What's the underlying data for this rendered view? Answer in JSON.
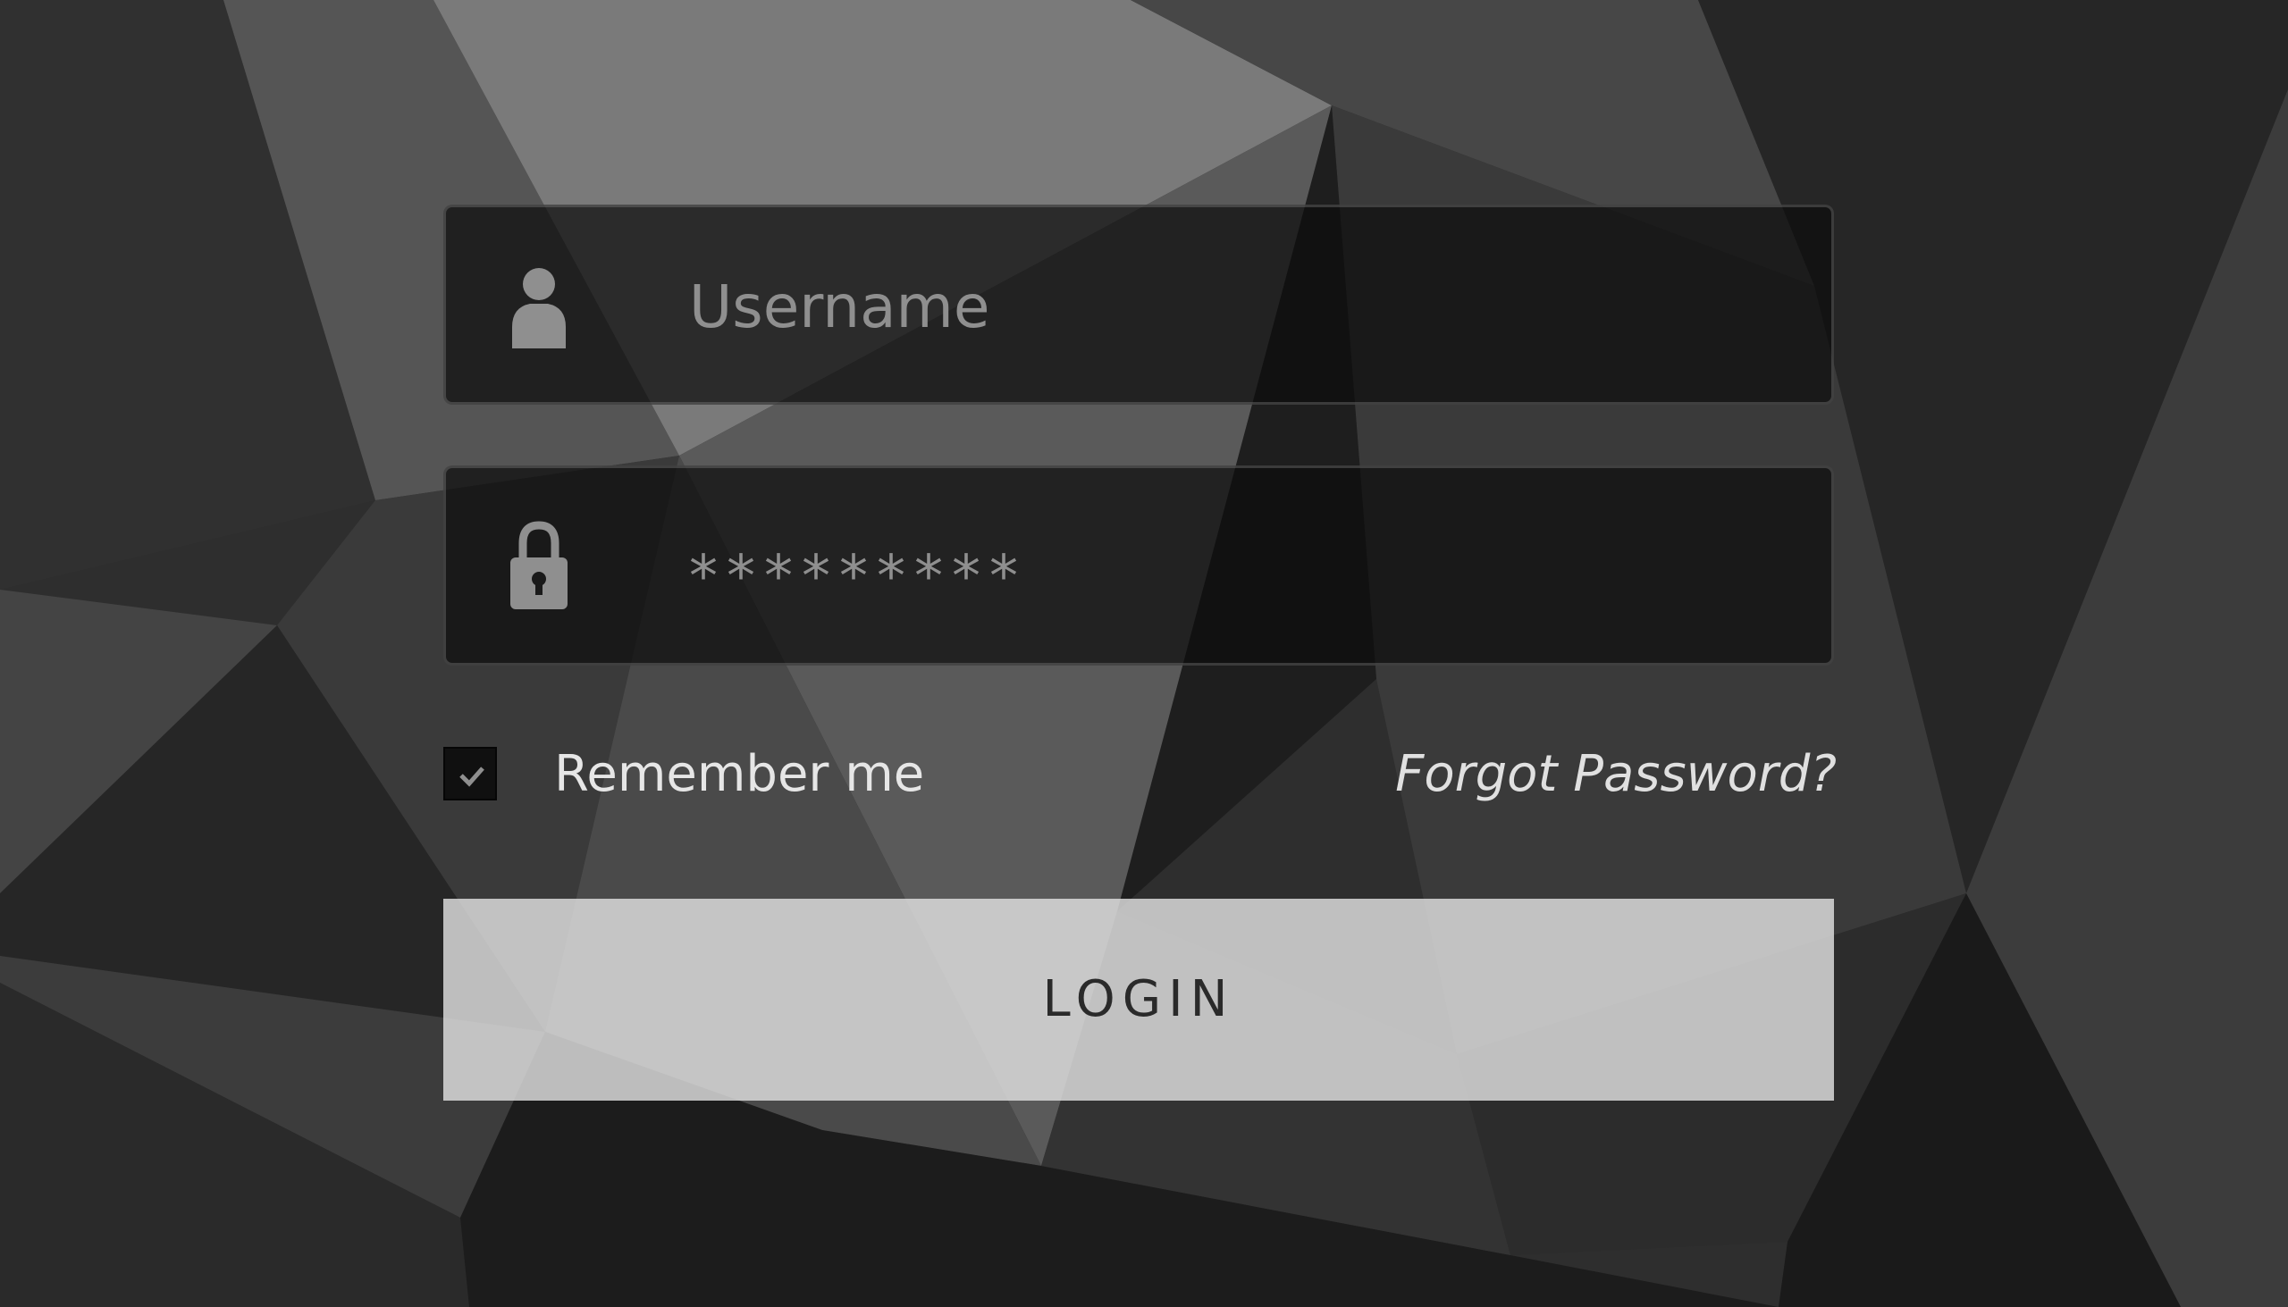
{
  "form": {
    "username_placeholder": "Username",
    "password_value": "*********",
    "remember_label": "Remember me",
    "remember_checked": true,
    "forgot_label": "Forgot Password?",
    "login_label": "LOGIN"
  },
  "icons": {
    "username": "user-icon",
    "password": "lock-icon",
    "checkbox": "check-icon"
  },
  "colors": {
    "field_background": "#0c0c0c",
    "placeholder_text": "#8f8f8f",
    "icon": "#8f8f8f",
    "label_text": "#e6e6e6",
    "button_background": "#e0e0e0",
    "button_text": "#2a2a2a"
  }
}
